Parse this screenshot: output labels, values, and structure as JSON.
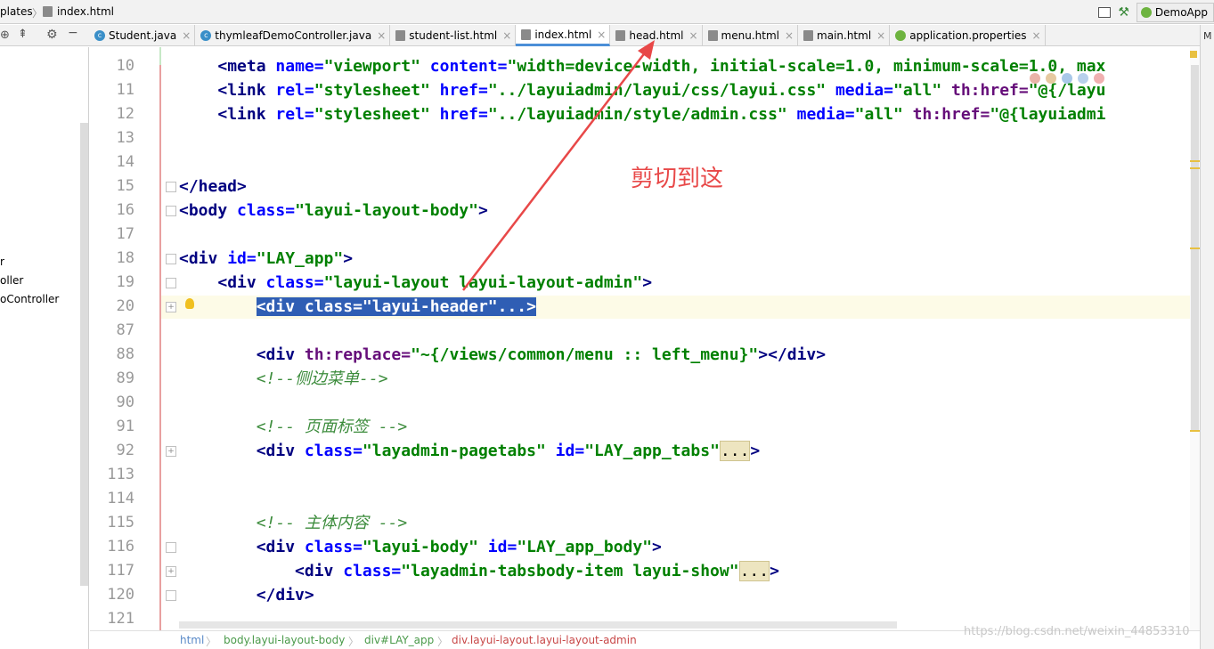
{
  "breadcrumb": {
    "parent": "plates",
    "file": "index.html"
  },
  "run_config": {
    "label": "DemoApp"
  },
  "side_panel": {
    "items": [
      "r",
      "oller",
      "oController"
    ]
  },
  "tabs": [
    {
      "label": "Student.java",
      "icon": "class-icon",
      "active": false
    },
    {
      "label": "thymleafDemoController.java",
      "icon": "class-icon",
      "active": false
    },
    {
      "label": "student-list.html",
      "icon": "html-file-icon",
      "active": false
    },
    {
      "label": "index.html",
      "icon": "html-file-icon",
      "active": true
    },
    {
      "label": "head.html",
      "icon": "html-file-icon",
      "active": false
    },
    {
      "label": "menu.html",
      "icon": "html-file-icon",
      "active": false
    },
    {
      "label": "main.html",
      "icon": "html-file-icon",
      "active": false
    },
    {
      "label": "application.properties",
      "icon": "spring-leaf-icon",
      "active": false
    }
  ],
  "line_numbers": [
    "10",
    "11",
    "12",
    "13",
    "14",
    "15",
    "16",
    "17",
    "18",
    "19",
    "20",
    "87",
    "88",
    "89",
    "90",
    "91",
    "92",
    "113",
    "114",
    "115",
    "116",
    "117",
    "120",
    "121"
  ],
  "code": {
    "l10": {
      "indent": "    ",
      "t1": "<meta ",
      "a1": "name=",
      "v1": "\"viewport\"",
      "a2": " content=",
      "v2": "\"width=device-width, initial-scale=1.0, minimum-scale=1.0, max"
    },
    "l11": {
      "indent": "    ",
      "t1": "<link ",
      "a1": "rel=",
      "v1": "\"stylesheet\"",
      "a2": " href=",
      "v2": "\"../layuiadmin/layui/css/layui.css\"",
      "a3": " media=",
      "v3": "\"all\"",
      "a4": " th:href=",
      "v4": "\"@{/layu"
    },
    "l12": {
      "indent": "    ",
      "t1": "<link ",
      "a1": "rel=",
      "v1": "\"stylesheet\"",
      "a2": " href=",
      "v2": "\"../layuiadmin/style/admin.css\"",
      "a3": " media=",
      "v3": "\"all\"",
      "a4": " th:href=",
      "v4": "\"@{layuiadmi"
    },
    "l15": "</head>",
    "l16": {
      "t1": "<body ",
      "a1": "class=",
      "v1": "\"layui-layout-body\"",
      "t2": ">"
    },
    "l18": {
      "t1": "<div ",
      "a1": "id=",
      "v1": "\"LAY_app\"",
      "t2": ">"
    },
    "l19": {
      "indent": "    ",
      "t1": "<div ",
      "a1": "class=",
      "v1": "\"layui-layout layui-layout-admin\"",
      "t2": ">"
    },
    "l20": {
      "indent": "        ",
      "selected": "<div class=\"layui-header\"...>"
    },
    "l88": {
      "indent": "        ",
      "t1": "<div ",
      "a1": "th:replace=",
      "v1": "\"~{/views/common/menu :: left_menu}\"",
      "t2": "></div>"
    },
    "l89": {
      "indent": "        ",
      "comment": "<!--侧边菜单-->"
    },
    "l91": {
      "indent": "        ",
      "comment": "<!-- 页面标签 -->"
    },
    "l92": {
      "indent": "        ",
      "t1": "<div ",
      "a1": "class=",
      "v1": "\"layadmin-pagetabs\"",
      "a2": " id=",
      "v2": "\"LAY_app_tabs\"",
      "fold": "...",
      "t2": ">"
    },
    "l115": {
      "indent": "        ",
      "comment": "<!-- 主体内容 -->"
    },
    "l116": {
      "indent": "        ",
      "t1": "<div ",
      "a1": "class=",
      "v1": "\"layui-body\"",
      "a2": " id=",
      "v2": "\"LAY_app_body\"",
      "t2": ">"
    },
    "l117": {
      "indent": "            ",
      "t1": "<div ",
      "a1": "class=",
      "v1": "\"layadmin-tabsbody-item layui-show\"",
      "fold": "...",
      "t2": ">"
    },
    "l120": {
      "indent": "        ",
      "t1": "</div>"
    }
  },
  "annotation": {
    "text": "剪切到这",
    "color": "#e84848"
  },
  "status_breadcrumb": [
    "html",
    "body.layui-layout-body",
    "div#LAY_app",
    "div.layui-layout.layui-layout-admin"
  ],
  "watermark": "https://blog.csdn.net/weixin_44853310",
  "colors": {
    "tag": "#000080",
    "attribute": "#0000ff",
    "value": "#008000",
    "comment": "#808080",
    "selection": "#2f5eb4",
    "annotation": "#e84848"
  }
}
